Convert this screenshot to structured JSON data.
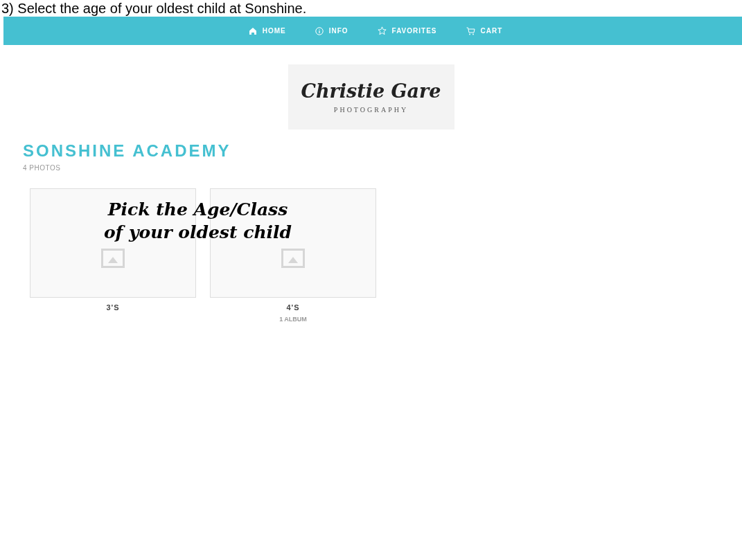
{
  "instruction": "3) Select the age of your oldest child at Sonshine.",
  "nav": [
    {
      "label": "HOME",
      "kind": "home"
    },
    {
      "label": "INFO",
      "kind": "info"
    },
    {
      "label": "FAVORITES",
      "kind": "star"
    },
    {
      "label": "CART",
      "kind": "cart"
    }
  ],
  "logo": {
    "name": "Christie Gare",
    "tagline": "PHOTOGRAPHY"
  },
  "gallery": {
    "title": "SONSHINE ACADEMY",
    "count": "4 PHOTOS"
  },
  "overlay": [
    "Pick the Age/Class",
    "of your oldest child"
  ],
  "albums": [
    {
      "label": "3'S"
    },
    {
      "label": "4'S",
      "sub": "1 ALBUM"
    }
  ]
}
